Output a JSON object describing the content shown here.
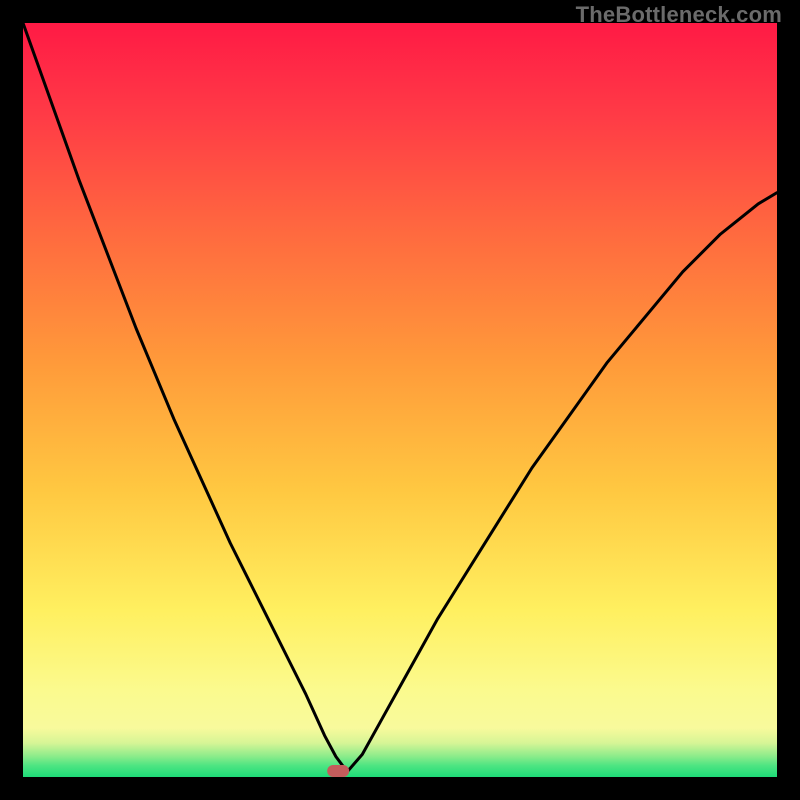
{
  "watermark": "TheBottleneck.com",
  "chart_data": {
    "type": "line",
    "title": "",
    "xlabel": "",
    "ylabel": "",
    "xlim": [
      0,
      100
    ],
    "ylim": [
      0,
      100
    ],
    "grid": false,
    "series": [
      {
        "name": "curve",
        "x": [
          0,
          2.5,
          5,
          7.5,
          10,
          12.5,
          15,
          17.5,
          20,
          22.5,
          25,
          27.5,
          30,
          32.5,
          35,
          37.5,
          38.5,
          40,
          41.5,
          43,
          45,
          47.5,
          50,
          52.5,
          55,
          57.5,
          60,
          62.5,
          65,
          67.5,
          70,
          72.5,
          75,
          77.5,
          80,
          82.5,
          85,
          87.5,
          90,
          92.5,
          95,
          97.5,
          100
        ],
        "y": [
          100,
          93,
          86,
          79,
          72.5,
          66,
          59.5,
          53.5,
          47.5,
          42,
          36.5,
          31,
          26,
          21,
          16,
          11,
          8.8,
          5.5,
          2.7,
          0.7,
          3,
          7.5,
          12,
          16.5,
          21,
          25,
          29,
          33,
          37,
          41,
          44.5,
          48,
          51.5,
          55,
          58,
          61,
          64,
          67,
          69.5,
          72,
          74,
          76,
          77.5
        ]
      }
    ],
    "marker": {
      "x": 41.8,
      "y": 0.8,
      "color": "#c45c5c"
    },
    "bands": [
      {
        "from": 0,
        "to": 1.5,
        "color": "#23e07b"
      },
      {
        "from": 1.5,
        "to": 3.5,
        "color": "#6ae884"
      },
      {
        "from": 3.5,
        "to": 6,
        "color": "#bdf18f"
      },
      {
        "from": 6,
        "to": 15,
        "color": "#f7f99a"
      },
      {
        "from": 15,
        "to": 100,
        "gradient": [
          "#fff79a",
          "#ff1a45"
        ]
      }
    ]
  }
}
